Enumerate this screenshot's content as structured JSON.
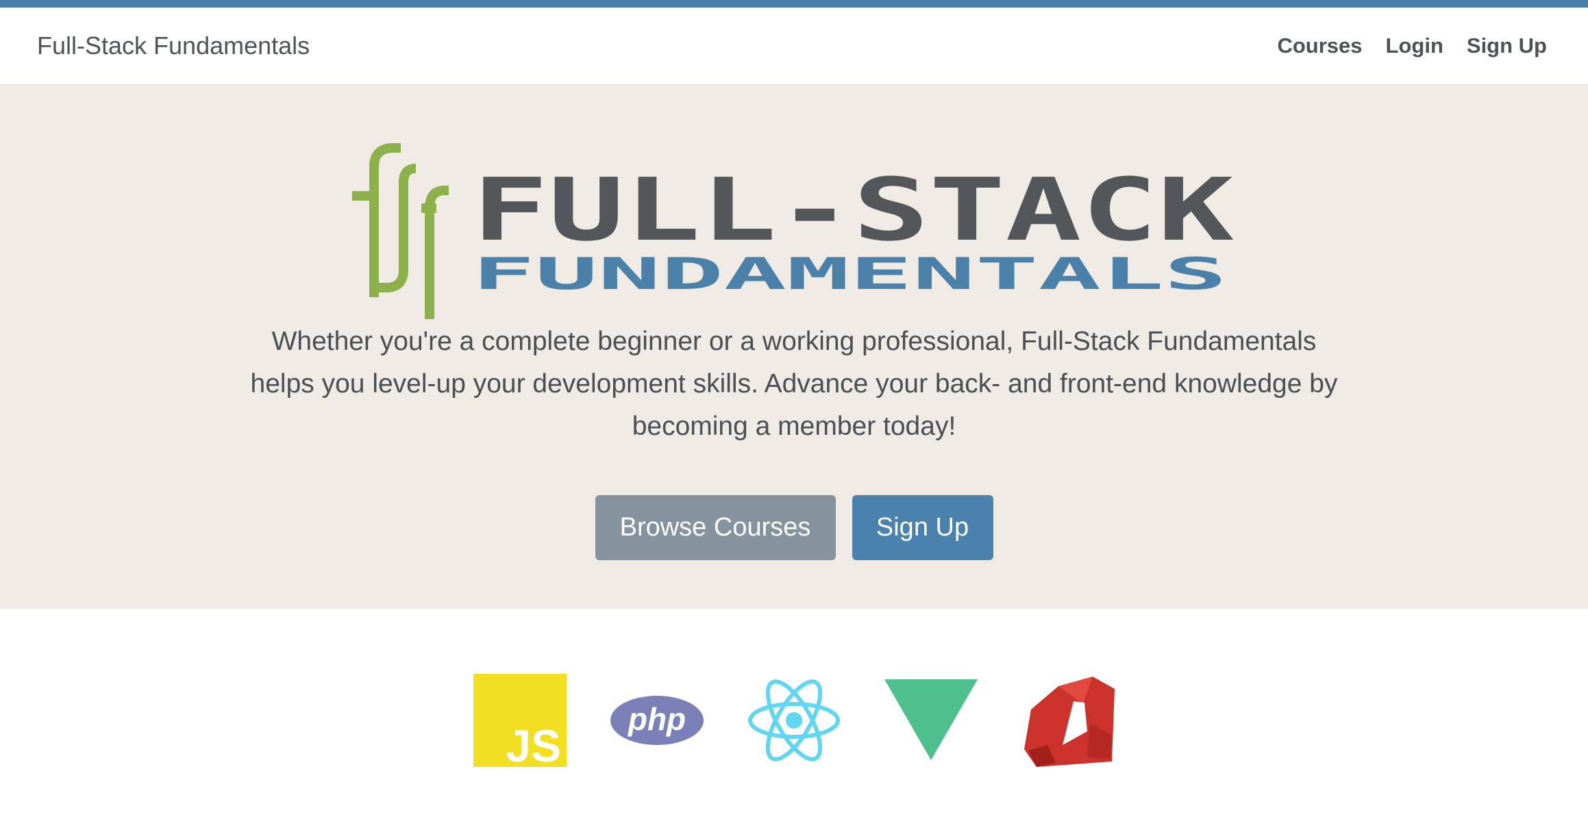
{
  "navbar": {
    "brand": "Full-Stack Fundamentals",
    "links": [
      "Courses",
      "Login",
      "Sign Up"
    ]
  },
  "hero": {
    "logo": {
      "word1": "FULL-STACK",
      "word2": "FUNDAMENTALS"
    },
    "lead": "Whether you're a complete beginner or a working professional, Full-Stack Fundamentals helps you level-up your development skills. Advance your back- and front-end knowledge by becoming a member today!",
    "buttons": {
      "browse": "Browse Courses",
      "signup": "Sign Up"
    }
  },
  "tech_icons": [
    {
      "name": "javascript-icon",
      "label": "JS"
    },
    {
      "name": "php-icon",
      "label": "php"
    },
    {
      "name": "react-icon"
    },
    {
      "name": "vue-icon"
    },
    {
      "name": "ruby-icon"
    }
  ],
  "colors": {
    "accent": "#4b81a9",
    "hero_bg": "#efeae4",
    "logo_green": "#8db14a",
    "logo_gray": "#53575a",
    "logo_blue": "#4b81a9",
    "btn_secondary": "#84939d",
    "btn_primary": "#4a82ad"
  }
}
